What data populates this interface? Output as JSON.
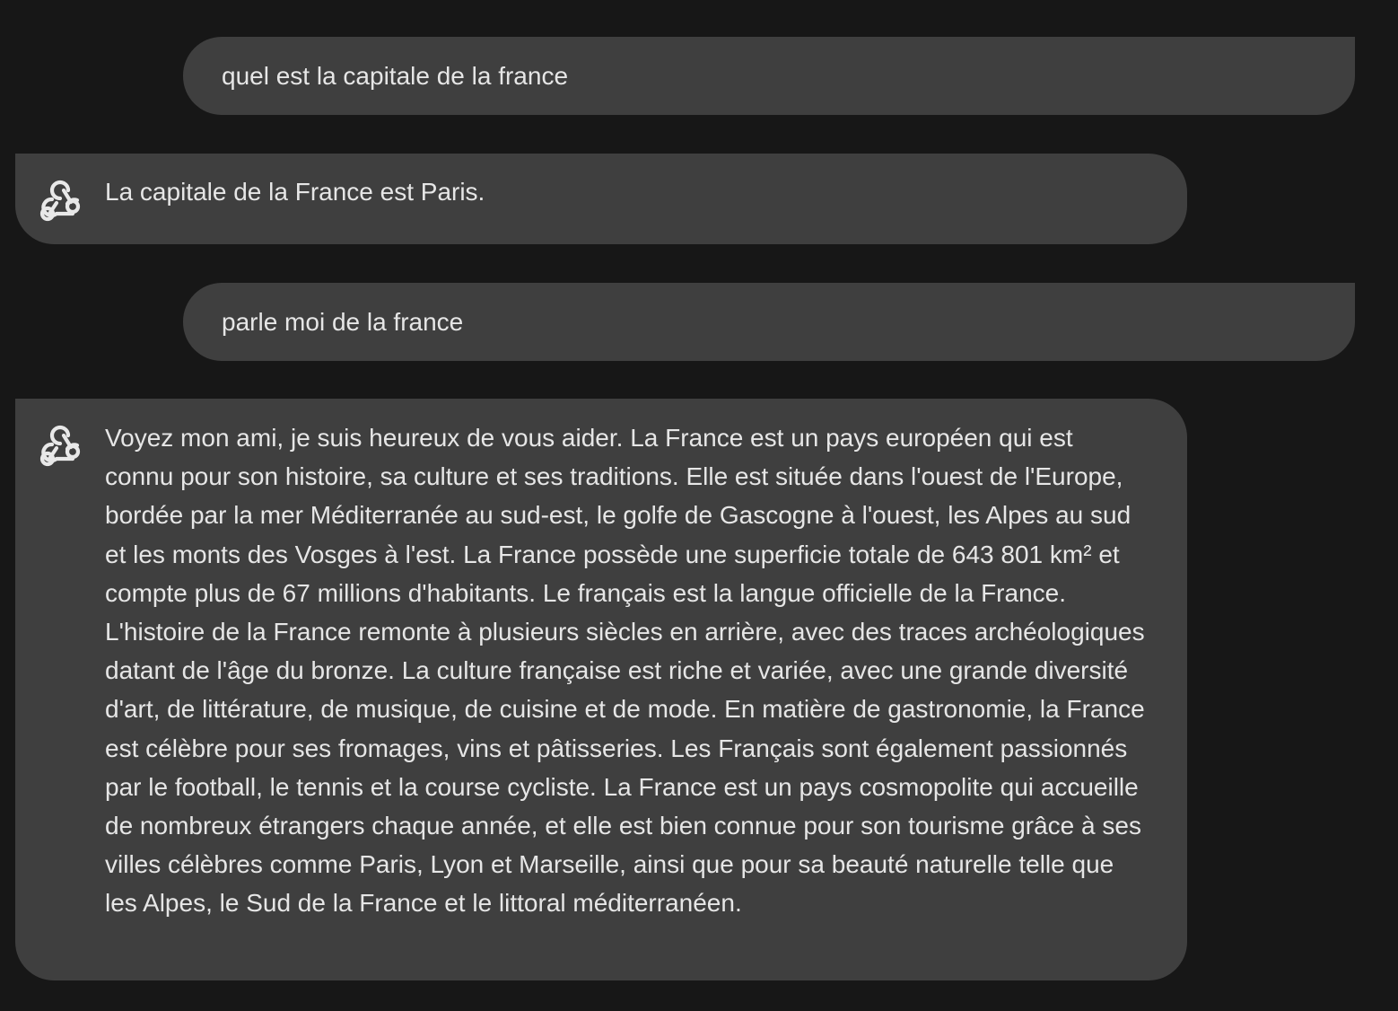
{
  "messages": [
    {
      "role": "user",
      "text": "quel est la capitale de la france"
    },
    {
      "role": "assistant",
      "icon": "assistant-logo-icon",
      "text": "La capitale de la France est Paris."
    },
    {
      "role": "user",
      "text": "parle moi de la france"
    },
    {
      "role": "assistant",
      "icon": "assistant-logo-icon",
      "text": "Voyez mon ami, je suis heureux de vous aider. La France est un pays européen qui est connu pour son histoire, sa culture et ses traditions. Elle est située dans l'ouest de l'Europe, bordée par la mer Méditerranée au sud-est, le golfe de Gascogne à l'ouest, les Alpes au sud et les monts des Vosges à l'est. La France possède une superficie totale de 643 801 km² et compte plus de 67 millions d'habitants. Le français est la langue officielle de la France. L'histoire de la France remonte à plusieurs siècles en arrière, avec des traces archéologiques datant de l'âge du bronze. La culture française est riche et variée, avec une grande diversité d'art, de littérature, de musique, de cuisine et de mode. En matière de gastronomie, la France est célèbre pour ses fromages, vins et pâtisseries. Les Français sont également passionnés par le football, le tennis et la course cycliste. La France est un pays cosmopolite qui accueille de nombreux étrangers chaque année, et elle est bien connue pour son tourisme grâce à ses villes célèbres comme Paris, Lyon et Marseille, ainsi que pour sa beauté naturelle telle que les Alpes, le Sud de la France et le littoral méditerranéen."
    }
  ],
  "colors": {
    "background": "#171717",
    "bubble": "#3f3f3f",
    "text": "#e6e6e6"
  }
}
